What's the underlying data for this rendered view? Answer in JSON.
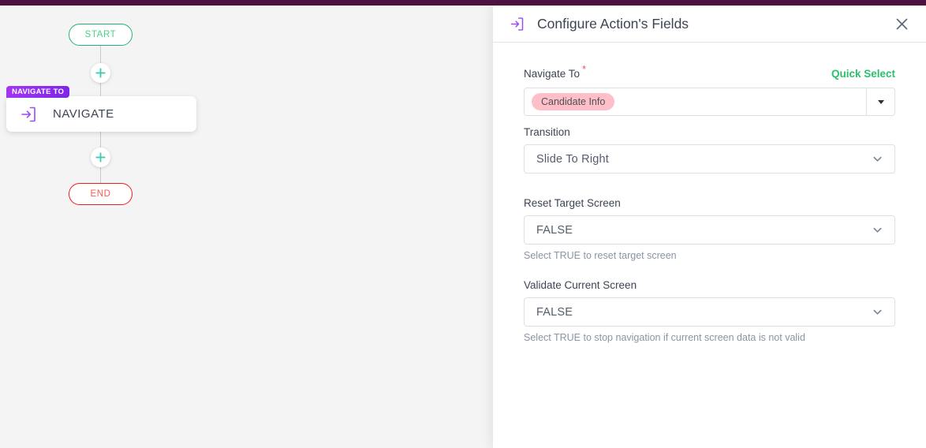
{
  "flow": {
    "start_label": "START",
    "end_label": "END",
    "add_button_label": "+",
    "node": {
      "badge": "NAVIGATE TO",
      "label": "NAVIGATE",
      "icon": "navigate-arrow-into-box-icon"
    },
    "colors": {
      "start_border": "#22b573",
      "start_text": "#4cd08a",
      "end_border": "#f01c1c",
      "end_text": "#fa5a52",
      "badge": "#a435f5",
      "canvas_bg": "#f4f4f4",
      "connector": "#c9c9c9",
      "plus": "#2bbf6b"
    }
  },
  "panel": {
    "icon": "navigate-arrow-into-box-icon",
    "title": "Configure Action's Fields",
    "close_icon": "close-icon",
    "accent_bar_color": "#4c1342",
    "fields": {
      "navigate_to": {
        "label": "Navigate To",
        "required_marker": "*",
        "quick_select_label": "Quick Select",
        "quick_select_color": "#2bbf6b",
        "selected_chips": [
          "Candidate Info"
        ],
        "chip_color": "#ffbfc9",
        "caret_icon": "caret-down-icon"
      },
      "transition": {
        "label": "Transition",
        "value": "Slide To Right",
        "chevron_icon": "chevron-down-icon"
      },
      "reset_target_screen": {
        "label": "Reset Target Screen",
        "value": "FALSE",
        "help": "Select TRUE to reset target screen",
        "chevron_icon": "chevron-down-icon"
      },
      "validate_current_screen": {
        "label": "Validate Current Screen",
        "value": "FALSE",
        "help": "Select TRUE to stop navigation if current screen data is not valid",
        "chevron_icon": "chevron-down-icon"
      }
    }
  }
}
